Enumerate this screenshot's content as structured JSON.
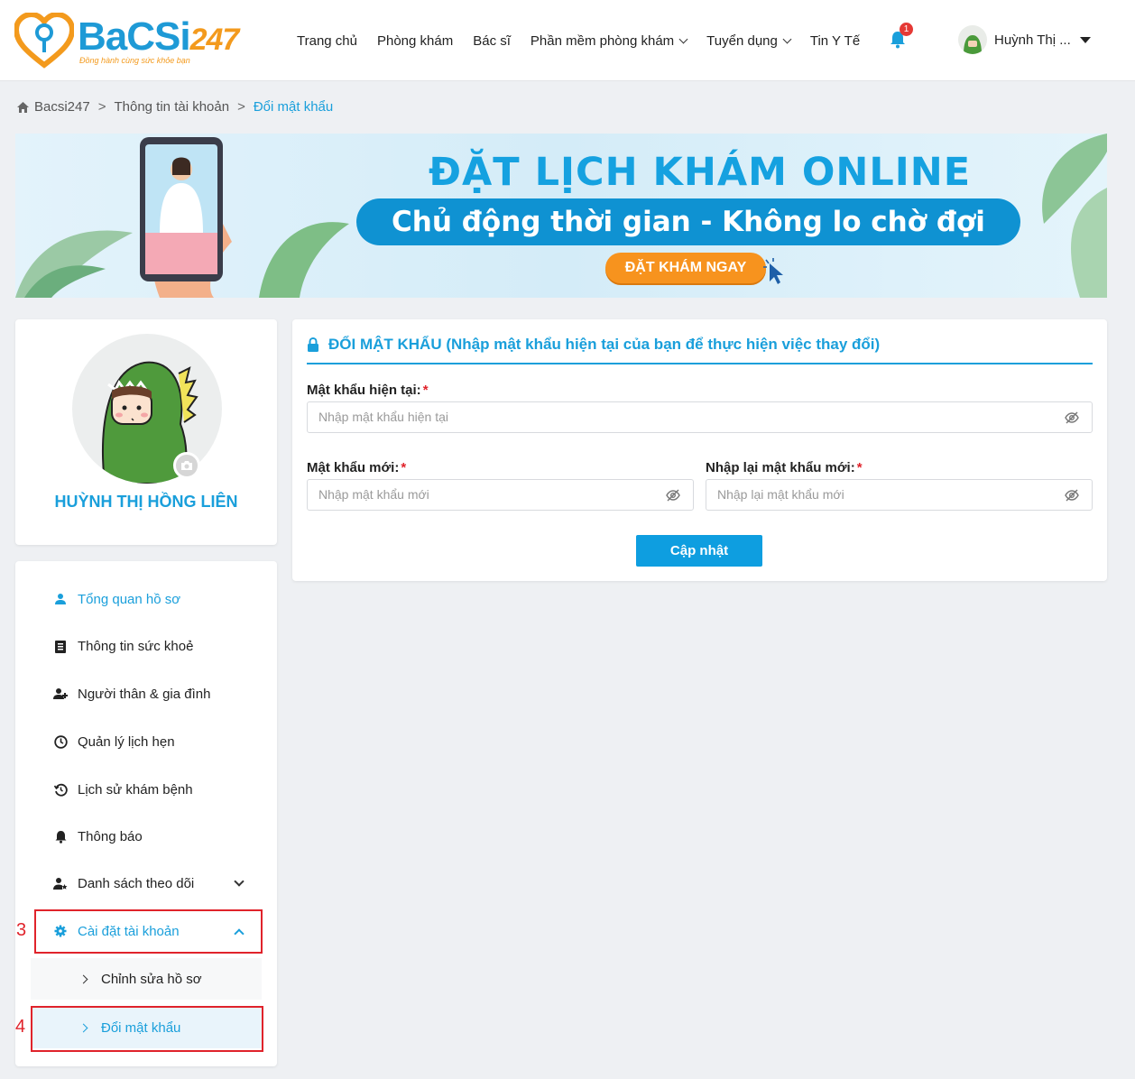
{
  "header": {
    "logo": {
      "wordmark": "BaCSi",
      "wordmark_num": "247",
      "tagline": "Đồng hành cùng sức khỏe bạn"
    },
    "nav": [
      {
        "label": "Trang chủ",
        "dropdown": false
      },
      {
        "label": "Phòng khám",
        "dropdown": false
      },
      {
        "label": "Bác sĩ",
        "dropdown": false
      },
      {
        "label": "Phần mềm phòng khám",
        "dropdown": true
      },
      {
        "label": "Tuyển dụng",
        "dropdown": true
      },
      {
        "label": "Tin Y Tế",
        "dropdown": false
      }
    ],
    "notification_count": "1",
    "user_name": "Huỳnh Thị ..."
  },
  "breadcrumb": {
    "home": "Bacsi247",
    "sep": ">",
    "level1": "Thông tin tài khoản",
    "current": "Đổi mật khẩu"
  },
  "banner": {
    "headline": "ĐẶT LỊCH KHÁM ONLINE",
    "subheadline": "Chủ động thời gian - Không lo chờ đợi",
    "cta": "ĐẶT KHÁM NGAY"
  },
  "profile": {
    "name": "HUỲNH THỊ HỒNG LIÊN"
  },
  "sidebar": {
    "items": [
      {
        "label": "Tổng quan hồ sơ",
        "icon": "user-icon",
        "active": true
      },
      {
        "label": "Thông tin sức khoẻ",
        "icon": "clipboard-icon"
      },
      {
        "label": "Người thân & gia đình",
        "icon": "user-plus-icon"
      },
      {
        "label": "Quản lý lịch hẹn",
        "icon": "clock-icon"
      },
      {
        "label": "Lịch sử khám bệnh",
        "icon": "history-icon"
      },
      {
        "label": "Thông báo",
        "icon": "bell-icon"
      },
      {
        "label": "Danh sách theo dõi",
        "icon": "user-star-icon",
        "expand": "down"
      },
      {
        "label": "Cài đặt tài khoản",
        "icon": "gear-icon",
        "expand": "up",
        "active": true
      }
    ],
    "subitems": [
      {
        "label": "Chỉnh sửa hồ sơ"
      },
      {
        "label": "Đổi mật khẩu",
        "active": true
      }
    ],
    "annotations": {
      "step3": "3",
      "step4": "4"
    }
  },
  "form": {
    "title": "ĐỔI MẬT KHẨU (Nhập mật khẩu hiện tại của bạn để thực hiện việc thay đổi)",
    "current_password": {
      "label": "Mật khẩu hiện tại:",
      "required": "*",
      "placeholder": "Nhập mật khẩu hiện tại",
      "value": ""
    },
    "new_password": {
      "label": "Mật khẩu mới:",
      "required": "*",
      "placeholder": "Nhập mật khẩu mới",
      "value": ""
    },
    "confirm_password": {
      "label": "Nhập lại mật khẩu mới:",
      "required": "*",
      "placeholder": "Nhập lại mật khẩu mới",
      "value": ""
    },
    "submit_label": "Cập nhật"
  },
  "colors": {
    "accent": "#1a9fdb",
    "brand_orange": "#f39a1d",
    "annotation_red": "#e0232b",
    "button_blue": "#0e9ee0"
  }
}
